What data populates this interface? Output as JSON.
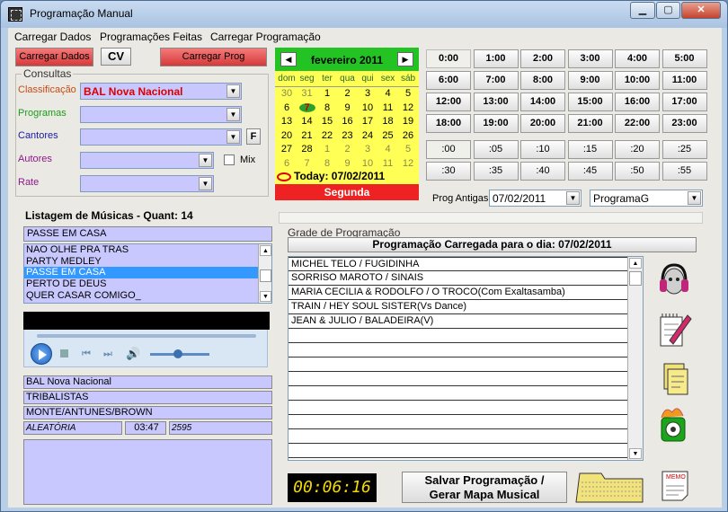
{
  "window": {
    "title": "Programação Manual",
    "min_label": "▁",
    "max_label": "▢",
    "close_label": "✕"
  },
  "menu": [
    "Carregar Dados",
    "Programações Feitas",
    "Carregar Programação"
  ],
  "toolbar": {
    "carregar_dados": "Carregar Dados",
    "cv": "CV",
    "carregar_prog": "Carregar Prog"
  },
  "consultas": {
    "title": "Consultas",
    "classificacao_label": "Classificação",
    "classificacao_value": "BAL Nova Nacional",
    "programas_label": "Programas",
    "cantores_label": "Cantores",
    "f_button": "F",
    "autores_label": "Autores",
    "mix_label": "Mix",
    "rate_label": "Rate"
  },
  "calendar": {
    "month": "fevereiro 2011",
    "days": [
      "dom",
      "seg",
      "ter",
      "qua",
      "qui",
      "sex",
      "sáb"
    ],
    "weeks": [
      [
        "30",
        "31",
        "1",
        "2",
        "3",
        "4",
        "5"
      ],
      [
        "6",
        "7",
        "8",
        "9",
        "10",
        "11",
        "12"
      ],
      [
        "13",
        "14",
        "15",
        "16",
        "17",
        "18",
        "19"
      ],
      [
        "20",
        "21",
        "22",
        "23",
        "24",
        "25",
        "26"
      ],
      [
        "27",
        "28",
        "1",
        "2",
        "3",
        "4",
        "5"
      ],
      [
        "6",
        "7",
        "8",
        "9",
        "10",
        "11",
        "12"
      ]
    ],
    "today": "Today: 07/02/2011",
    "weekday": "Segunda",
    "colors": {
      "header": "#22c322",
      "body": "#ffff55",
      "bar": "#ee2222"
    }
  },
  "hours": [
    "0:00",
    "1:00",
    "2:00",
    "3:00",
    "4:00",
    "5:00",
    "6:00",
    "7:00",
    "8:00",
    "9:00",
    "10:00",
    "11:00",
    "12:00",
    "13:00",
    "14:00",
    "15:00",
    "16:00",
    "17:00",
    "18:00",
    "19:00",
    "20:00",
    "21:00",
    "22:00",
    "23:00"
  ],
  "minutes": [
    ":00",
    ":05",
    ":10",
    ":15",
    ":20",
    ":25",
    ":30",
    ":35",
    ":40",
    ":45",
    ":50",
    ":55"
  ],
  "prog_antigas": {
    "label": "Prog Antigas",
    "date": "07/02/2011",
    "programa": "ProgramaG"
  },
  "listagem": {
    "header": "Listagem de Músicas - Quant: 14",
    "search_value": "PASSE EM CASA",
    "items": [
      "NAO OLHE PRA TRAS",
      "PARTY MEDLEY",
      "PASSE EM CASA",
      "PERTO DE DEUS",
      "QUER CASAR COMIGO_"
    ],
    "selected_index": 2
  },
  "info": {
    "classificacao": "BAL Nova Nacional",
    "cantor": "TRIBALISTAS",
    "autores": "MONTE/ANTUNES/BROWN",
    "modo": "ALEATÓRIA",
    "duracao": "03:47",
    "codigo": "2595"
  },
  "grade": {
    "title": "Grade de Programação",
    "loaded": "Programação Carregada para o dia: 07/02/2011",
    "rows": [
      "MICHEL TELO / FUGIDINHA",
      "SORRISO MAROTO / SINAIS",
      "MARIA CECILIA & RODOLFO / O TROCO(Com Exaltasamba)",
      "TRAIN / HEY SOUL SISTER(Vs Dance)",
      "JEAN & JULIO / BALADEIRA(V)",
      "",
      "",
      "",
      "",
      "",
      "",
      "",
      "",
      ""
    ]
  },
  "bottom": {
    "timer": "00:06:16",
    "save_line1": "Salvar Programação /",
    "save_line2": "Gerar Mapa Musical",
    "memo_label": "MEMO"
  }
}
